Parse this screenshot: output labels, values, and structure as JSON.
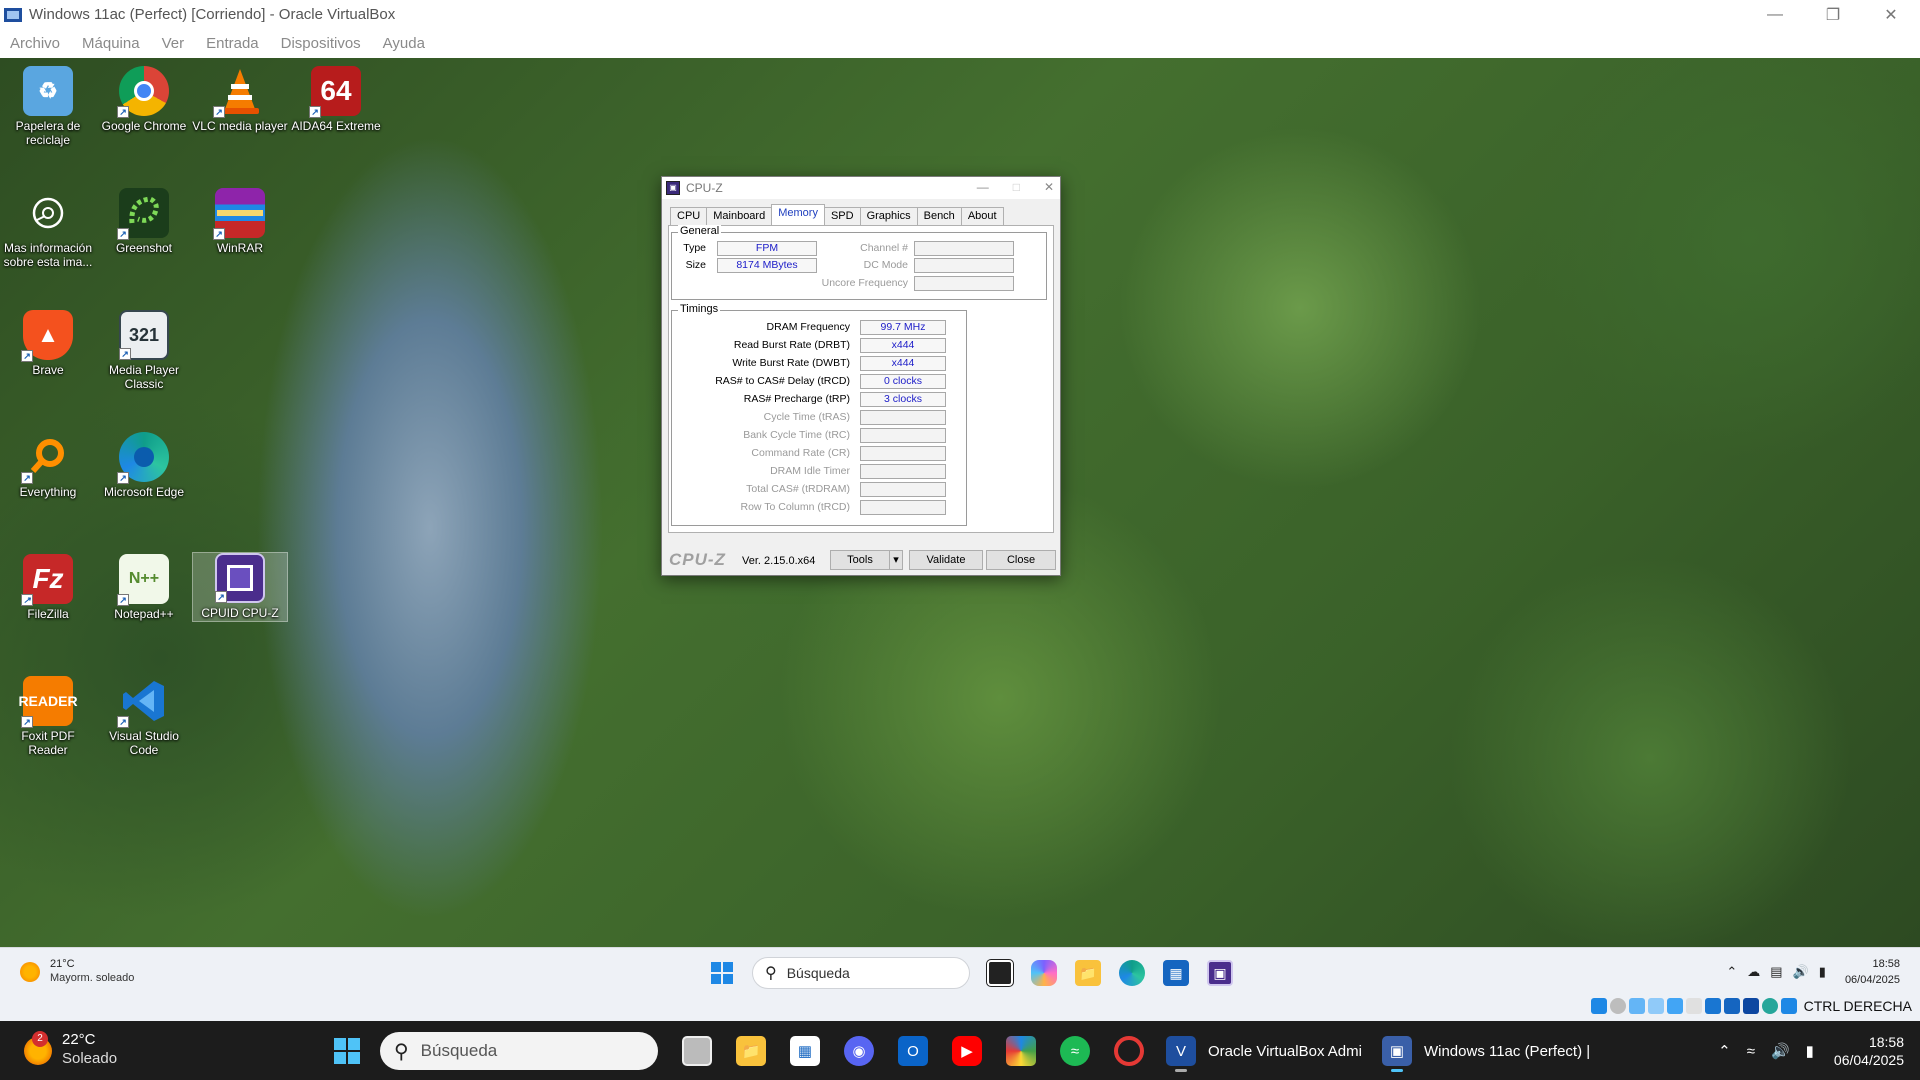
{
  "vbox": {
    "title": "Windows 11ac (Perfect) [Corriendo] - Oracle VirtualBox",
    "menu": [
      "Archivo",
      "Máquina",
      "Ver",
      "Entrada",
      "Dispositivos",
      "Ayuda"
    ],
    "host_key": "CTRL DERECHA"
  },
  "desktop_icons": [
    {
      "label": "Papelera de reciclaje",
      "icon": "recycle-bin-icon",
      "color": "#5aa6e0"
    },
    {
      "label": "Google Chrome",
      "icon": "chrome-icon",
      "color": "#db4437"
    },
    {
      "label": "VLC media player",
      "icon": "vlc-icon",
      "color": "#f57c00"
    },
    {
      "label": "AIDA64 Extreme",
      "icon": "aida64-icon",
      "color": "#c62828"
    },
    {
      "label": "Mas información sobre esta ima...",
      "icon": "info-icon",
      "color": "#222222"
    },
    {
      "label": "Greenshot",
      "icon": "greenshot-icon",
      "color": "#2e7d32"
    },
    {
      "label": "WinRAR",
      "icon": "winrar-icon",
      "color": "#6a1b9a"
    },
    {
      "label": "Brave",
      "icon": "brave-icon",
      "color": "#f4511e"
    },
    {
      "label": "Media Player Classic",
      "icon": "mpc-icon",
      "color": "#37474f"
    },
    {
      "label": "Everything",
      "icon": "everything-icon",
      "color": "#ff8f00"
    },
    {
      "label": "Microsoft Edge",
      "icon": "edge-icon",
      "color": "#0f9d8a"
    },
    {
      "label": "FileZilla",
      "icon": "filezilla-icon",
      "color": "#c62828"
    },
    {
      "label": "Notepad++",
      "icon": "notepadpp-icon",
      "color": "#8bc34a"
    },
    {
      "label": "CPUID CPU-Z",
      "icon": "cpuz-icon",
      "color": "#4a2d8c"
    },
    {
      "label": "Foxit PDF Reader",
      "icon": "foxit-icon",
      "color": "#f57c00"
    },
    {
      "label": "Visual Studio Code",
      "icon": "vscode-icon",
      "color": "#1976d2"
    }
  ],
  "cpuz": {
    "title": "CPU-Z",
    "tabs": [
      "CPU",
      "Mainboard",
      "Memory",
      "SPD",
      "Graphics",
      "Bench",
      "About"
    ],
    "active_tab": "Memory",
    "general": {
      "title": "General",
      "type_label": "Type",
      "type_value": "FPM",
      "size_label": "Size",
      "size_value": "8174 MBytes",
      "channel_label": "Channel #",
      "dc_mode_label": "DC Mode",
      "uncore_label": "Uncore Frequency"
    },
    "timings": {
      "title": "Timings",
      "rows": [
        {
          "label": "DRAM Frequency",
          "value": "99.7 MHz"
        },
        {
          "label": "Read Burst Rate (DRBT)",
          "value": "x444"
        },
        {
          "label": "Write Burst Rate (DWBT)",
          "value": "x444"
        },
        {
          "label": "RAS# to CAS# Delay (tRCD)",
          "value": "0 clocks"
        },
        {
          "label": "RAS# Precharge (tRP)",
          "value": "3 clocks"
        },
        {
          "label": "Cycle Time (tRAS)",
          "value": ""
        },
        {
          "label": "Bank Cycle Time (tRC)",
          "value": ""
        },
        {
          "label": "Command Rate (CR)",
          "value": ""
        },
        {
          "label": "DRAM Idle Timer",
          "value": ""
        },
        {
          "label": "Total CAS# (tRDRAM)",
          "value": ""
        },
        {
          "label": "Row To Column (tRCD)",
          "value": ""
        }
      ]
    },
    "logo": "CPU-Z",
    "version": "Ver. 2.15.0.x64",
    "buttons": {
      "tools": "Tools",
      "validate": "Validate",
      "close": "Close"
    }
  },
  "guest_taskbar": {
    "weather_temp": "21°C",
    "weather_desc": "Mayorm. soleado",
    "search_placeholder": "Búsqueda",
    "time": "18:58",
    "date": "06/04/2025"
  },
  "host_taskbar": {
    "weather_temp": "22°C",
    "weather_desc": "Soleado",
    "weather_badge": "2",
    "search_placeholder": "Búsqueda",
    "running_apps": [
      "Oracle VirtualBox Admi",
      "Windows 11ac (Perfect) |"
    ],
    "time": "18:58",
    "date": "06/04/2025"
  }
}
